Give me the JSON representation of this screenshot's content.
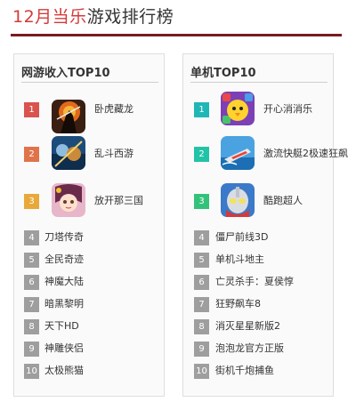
{
  "header": {
    "title_highlight": "12月当乐",
    "title_rest": "游戏排行榜"
  },
  "colors": {
    "accent_red": "#d43a3a",
    "rule_dark": "#7a1a22",
    "rank1": "#d9534f",
    "rank2": "#e0734a",
    "rank3": "#e8a93a",
    "teal1": "#1fb6b6",
    "teal2": "#22c3a6",
    "teal3": "#33c27a",
    "rank_plain": "#9e9e9e"
  },
  "left_panel": {
    "title": "网游收入TOP10",
    "items": [
      {
        "rank": "1",
        "name": "卧虎藏龙",
        "icon": "warrior-game-icon"
      },
      {
        "rank": "2",
        "name": "乱斗西游",
        "icon": "journey-game-icon"
      },
      {
        "rank": "3",
        "name": "放开那三国",
        "icon": "three-kingdoms-game-icon"
      },
      {
        "rank": "4",
        "name": "刀塔传奇"
      },
      {
        "rank": "5",
        "name": "全民奇迹"
      },
      {
        "rank": "6",
        "name": "神魔大陆"
      },
      {
        "rank": "7",
        "name": "暗黑黎明"
      },
      {
        "rank": "8",
        "name": "天下HD"
      },
      {
        "rank": "9",
        "name": "神雕侠侣"
      },
      {
        "rank": "10",
        "name": "太极熊猫"
      }
    ]
  },
  "right_panel": {
    "title": "单机TOP10",
    "items": [
      {
        "rank": "1",
        "name": "开心消消乐",
        "icon": "chick-puzzle-game-icon"
      },
      {
        "rank": "2",
        "name": "激流快艇2极速狂飙",
        "icon": "speedboat-game-icon"
      },
      {
        "rank": "3",
        "name": "酷跑超人",
        "icon": "ultraman-game-icon"
      },
      {
        "rank": "4",
        "name": "僵尸前线3D"
      },
      {
        "rank": "5",
        "name": "单机斗地主"
      },
      {
        "rank": "6",
        "name": "亡灵杀手：夏侯惇"
      },
      {
        "rank": "7",
        "name": "狂野飙车8"
      },
      {
        "rank": "8",
        "name": "消灭星星新版2"
      },
      {
        "rank": "9",
        "name": "泡泡龙官方正版"
      },
      {
        "rank": "10",
        "name": "街机千炮捕鱼"
      }
    ]
  }
}
